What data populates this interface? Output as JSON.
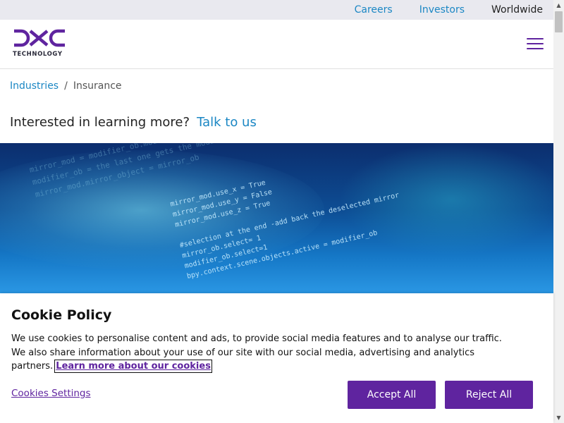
{
  "topbar": {
    "links": [
      "Careers",
      "Investors",
      "Worldwide"
    ]
  },
  "header": {
    "logo_mark": "DXC",
    "logo_text": "TECHNOLOGY",
    "menu_icon": "hamburger-icon"
  },
  "breadcrumb": {
    "parent": "Industries",
    "separator": "/",
    "current": "Insurance"
  },
  "cta": {
    "text": "Interested in learning more?",
    "link": "Talk to us"
  },
  "hero": {
    "code_lines": [
      "mirror_mod.use_x = True",
      "mirror_mod.use_y = False",
      "mirror_mod.use_z = True",
      "",
      "#selection at the end -add back the deselected mirror",
      "mirror_ob.select= 1",
      "modifier_ob.select=1",
      "bpy.context.scene.objects.active = modifier_ob"
    ]
  },
  "cookie": {
    "title": "Cookie Policy",
    "text": "We use cookies to personalise content and ads, to provide social media features and to analyse our traffic. We also share information about your use of our site with our social media, advertising and analytics partners.",
    "learn_more": "Learn more about our cookies",
    "settings_label": "Cookies Settings",
    "accept_label": "Accept All",
    "reject_label": "Reject All"
  },
  "colors": {
    "brand": "#5f249f",
    "link": "#1b87c4",
    "topbar_bg": "#e9e9ef"
  }
}
